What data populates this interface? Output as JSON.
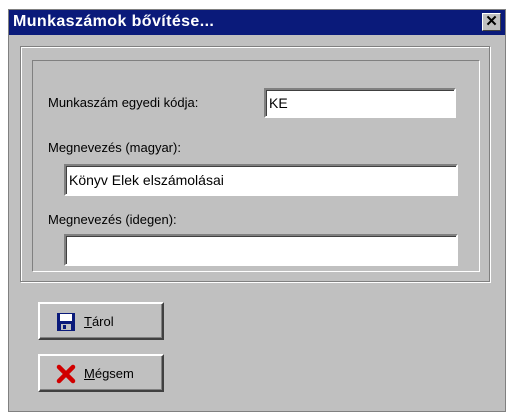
{
  "window": {
    "title": "Munkaszámok bővítése...",
    "close_glyph": "✕"
  },
  "form": {
    "code_label": "Munkaszám egyedi kódja:",
    "code_value": "KE",
    "name_hu_label": "Megnevezés (magyar):",
    "name_hu_value": "Könyv Elek elszámolásai",
    "name_foreign_label": "Megnevezés (idegen):",
    "name_foreign_value": ""
  },
  "buttons": {
    "save_label_first": "T",
    "save_label_rest": "árol",
    "save_icon": "floppy-disk-icon",
    "cancel_label_first": "M",
    "cancel_label_rest": "égsem",
    "cancel_icon": "red-x-icon"
  }
}
